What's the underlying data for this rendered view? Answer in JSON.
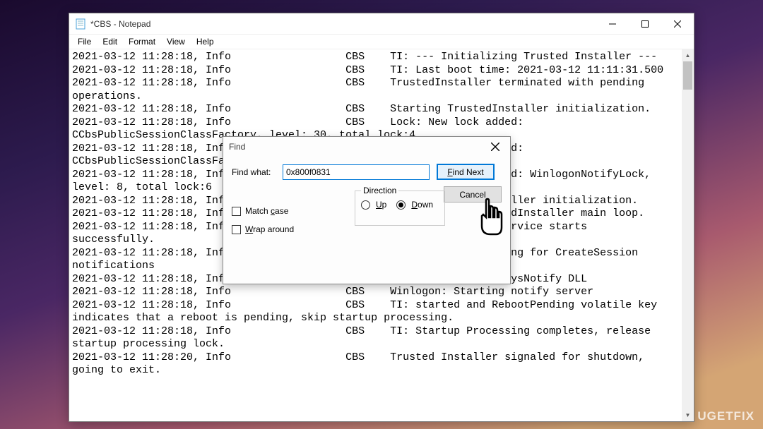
{
  "window": {
    "title": "*CBS - Notepad"
  },
  "menu": {
    "file": "File",
    "edit": "Edit",
    "format": "Format",
    "view": "View",
    "help": "Help"
  },
  "log_lines": [
    "2021-03-12 11:28:18, Info                  CBS    TI: --- Initializing Trusted Installer ---",
    "2021-03-12 11:28:18, Info                  CBS    TI: Last boot time: 2021-03-12 11:11:31.500",
    "2021-03-12 11:28:18, Info                  CBS    TrustedInstaller terminated with pending",
    "operations.",
    "2021-03-12 11:28:18, Info                  CBS    Starting TrustedInstaller initialization.",
    "2021-03-12 11:28:18, Info                  CBS    Lock: New lock added:",
    "CCbsPublicSessionClassFactory, level: 30, total lock:4",
    "2021-03-12 11:28:18, Info                  CBS    Lock: New lock added:",
    "CCbsPublicSessionClassFactory, level: 30, total lock:5",
    "2021-03-12 11:28:18, Info                  CBS    Lock: New lock added: WinlogonNotifyLock,",
    "level: 8, total lock:6",
    "2021-03-12 11:28:18, Info                  CBS    Ending TrustedInstaller initialization.",
    "2021-03-12 11:28:18, Info                  CBS    Starting the TrustedInstaller main loop.",
    "2021-03-12 11:28:18, Info                  CBS    TrustedInstaller service starts",
    "successfully.",
    "2021-03-12 11:28:18, Info                  CBS    Winlogon: Registering for CreateSession",
    "notifications",
    "2021-03-12 11:28:18, Info                  CBS    Winlogon: Loading SysNotify DLL",
    "2021-03-12 11:28:18, Info                  CBS    Winlogon: Starting notify server",
    "2021-03-12 11:28:18, Info                  CBS    TI: started and RebootPending volatile key",
    "indicates that a reboot is pending, skip startup processing.",
    "2021-03-12 11:28:18, Info                  CBS    TI: Startup Processing completes, release",
    "startup processing lock.",
    "2021-03-12 11:28:20, Info                  CBS    Trusted Installer signaled for shutdown,",
    "going to exit."
  ],
  "find": {
    "title": "Find",
    "findwhat_label": "Find what:",
    "findwhat_value": "0x800f0831",
    "findnext": "Find Next",
    "cancel": "Cancel",
    "matchcase": "Match case",
    "wraparound": "Wrap around",
    "direction_label": "Direction",
    "up": "Up",
    "down": "Down",
    "selected_direction": "down"
  },
  "watermark": "UGETFIX"
}
